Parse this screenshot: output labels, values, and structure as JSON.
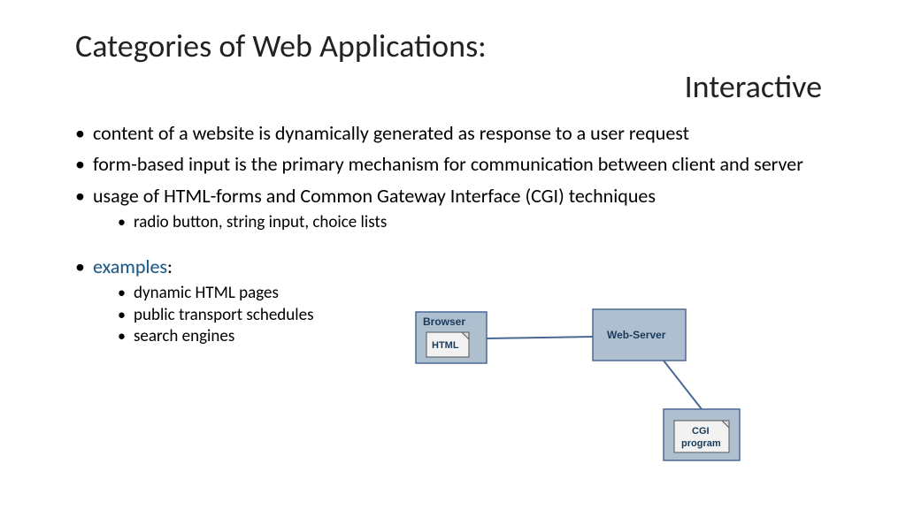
{
  "title": {
    "line1": "Categories of Web Applications:",
    "line2": "Interactive"
  },
  "bullets": {
    "b1": "content of a website is dynamically generated as response to a user request",
    "b2": "form-based input is the primary mechanism for communication between client and server",
    "b3": "usage of HTML-forms and Common Gateway Interface (CGI) techniques",
    "b3sub1": "radio button, string input, choice lists",
    "b4label": "examples",
    "b4colon": ":",
    "b4sub1": "dynamic HTML pages",
    "b4sub2": "public transport schedules",
    "b4sub3": "search engines"
  },
  "diagram": {
    "browser": "Browser",
    "html": "HTML",
    "webserver": "Web-Server",
    "cgi1": "CGI",
    "cgi2": "program"
  }
}
